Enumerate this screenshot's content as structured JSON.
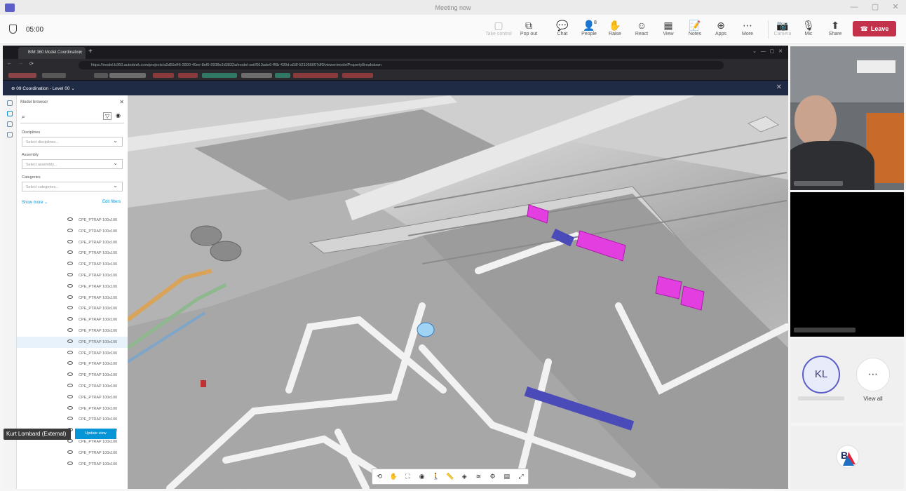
{
  "teams": {
    "window_title": "Meeting now",
    "timer": "05:00",
    "toolbar": [
      {
        "label": "Take control",
        "icon": "take-control-icon",
        "glyph": "▢",
        "disabled": true
      },
      {
        "label": "Pop out",
        "icon": "pop-out-icon",
        "glyph": "⧉",
        "disabled": false
      },
      {
        "label": "Chat",
        "icon": "chat-icon",
        "glyph": "💬",
        "disabled": false
      },
      {
        "label": "People",
        "icon": "people-icon",
        "glyph": "👤",
        "disabled": false
      },
      {
        "label": "Raise",
        "icon": "raise-hand-icon",
        "glyph": "✋",
        "disabled": false
      },
      {
        "label": "React",
        "icon": "react-icon",
        "glyph": "☺",
        "disabled": false
      },
      {
        "label": "View",
        "icon": "view-icon",
        "glyph": "▦",
        "disabled": false
      },
      {
        "label": "Notes",
        "icon": "notes-icon",
        "glyph": "📝",
        "disabled": false
      },
      {
        "label": "Apps",
        "icon": "apps-icon",
        "glyph": "⊕",
        "disabled": false
      },
      {
        "label": "More",
        "icon": "more-icon",
        "glyph": "⋯",
        "disabled": false
      },
      {
        "label": "Camera",
        "icon": "camera-off-icon",
        "glyph": "📷",
        "disabled": true
      },
      {
        "label": "Mic",
        "icon": "mic-off-icon",
        "glyph": "🎙",
        "disabled": false
      },
      {
        "label": "Share",
        "icon": "share-icon",
        "glyph": "⬆",
        "disabled": false
      }
    ],
    "people_count": "8",
    "leave_label": "Leave",
    "participant_initials": "KL",
    "view_all_label": "View all",
    "presenter_caption": "Kurt Lombard (External)"
  },
  "browser": {
    "tab_title": "BIM 360 Model Coordination",
    "url": "https://model.b360.autodesk.com/projects/a2d55d46-2800-40ee-8ef0-9938e2d3832a/model-set/f913ade6-ff6b-439d-a93f-521056607df0/viewer/modelPropertyBreakdown"
  },
  "bim": {
    "project_selector": "09 Coordination - Level 00",
    "model_browser_title": "Model browser",
    "disciplines_label": "Disciplines",
    "disciplines_placeholder": "Select disciplines...",
    "assembly_label": "Assembly",
    "assembly_placeholder": "Select assembly...",
    "categories_label": "Categories",
    "categories_placeholder": "Select categories...",
    "show_more_label": "Show more",
    "edit_filters_label": "Edit filters",
    "update_view_label": "Update view",
    "element_rows": [
      "CPE_PTRAP 100x100",
      "CPE_PTRAP 100x100",
      "CPE_PTRAP 100x100",
      "CPE_PTRAP 100x100",
      "CPE_PTRAP 100x100",
      "CPE_PTRAP 100x100",
      "CPE_PTRAP 100x100",
      "CPE_PTRAP 100x100",
      "CPE_PTRAP 100x100",
      "CPE_PTRAP 100x100",
      "CPE_PTRAP 100x100",
      "CPE_PTRAP 100x100",
      "CPE_PTRAP 100x100",
      "CPE_PTRAP 100x100",
      "CPE_PTRAP 100x100",
      "CPE_PTRAP 100x100",
      "CPE_PTRAP 100x100",
      "CPE_PTRAP 100x100",
      "CPE_PTRAP 100x100",
      "CPE_PTRAP 100x100",
      "CPE_PTRAP 100x100",
      "CPE_PTRAP 100x100",
      "CPE_PTRAP 100x100"
    ],
    "selected_row": 11,
    "viewer_tools": [
      {
        "icon": "orbit-icon",
        "glyph": "⟲"
      },
      {
        "icon": "pan-hand-icon",
        "glyph": "✋"
      },
      {
        "icon": "fit-view-icon",
        "glyph": "⛶"
      },
      {
        "icon": "camera-icon",
        "glyph": "◉"
      },
      {
        "icon": "first-person-icon",
        "glyph": "🚶"
      },
      {
        "icon": "measure-icon",
        "glyph": "📏"
      },
      {
        "icon": "section-icon",
        "glyph": "◈"
      },
      {
        "icon": "layers-icon",
        "glyph": "≋"
      },
      {
        "icon": "settings-icon",
        "glyph": "⚙"
      },
      {
        "icon": "properties-icon",
        "glyph": "▤"
      },
      {
        "icon": "fullscreen-icon",
        "glyph": "⤢"
      }
    ]
  },
  "colors": {
    "leave": "#c4314b",
    "accent_teams": "#5b5fc7",
    "accent_autodesk": "#0696d7",
    "clash_magenta": "#e23ee0"
  }
}
